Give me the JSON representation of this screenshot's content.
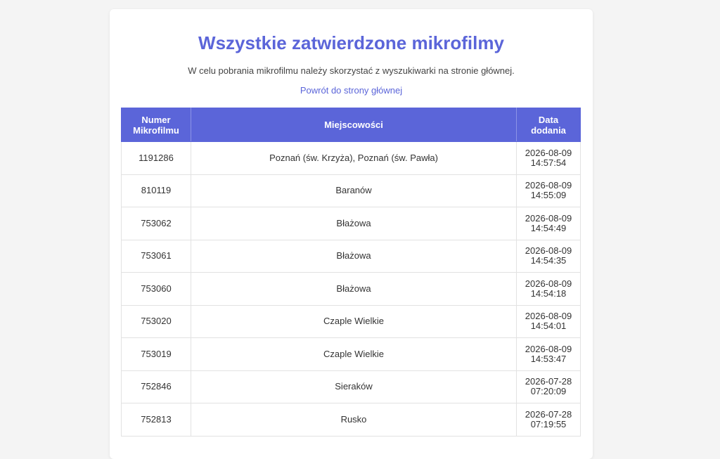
{
  "page": {
    "title": "Wszystkie zatwierdzone mikrofilmy",
    "subtitle": "W celu pobrania mikrofilmu należy skorzystać z wyszukiwarki na stronie głównej.",
    "back_link": "Powrót do strony głównej"
  },
  "colors": {
    "accent": "#5b65d9",
    "background": "#f4f4f4",
    "card": "#ffffff"
  },
  "table": {
    "headers": {
      "number": "Numer Mikrofilmu",
      "places": "Miejscowości",
      "date": "Data dodania"
    },
    "rows": [
      {
        "number": "1191286",
        "places": "Poznań (św. Krzyża), Poznań (św. Pawła)",
        "date": "2026-08-09",
        "time": "14:57:54"
      },
      {
        "number": "810119",
        "places": "Baranów",
        "date": "2026-08-09",
        "time": "14:55:09"
      },
      {
        "number": "753062",
        "places": "Błażowa",
        "date": "2026-08-09",
        "time": "14:54:49"
      },
      {
        "number": "753061",
        "places": "Błażowa",
        "date": "2026-08-09",
        "time": "14:54:35"
      },
      {
        "number": "753060",
        "places": "Błażowa",
        "date": "2026-08-09",
        "time": "14:54:18"
      },
      {
        "number": "753020",
        "places": "Czaple Wielkie",
        "date": "2026-08-09",
        "time": "14:54:01"
      },
      {
        "number": "753019",
        "places": "Czaple Wielkie",
        "date": "2026-08-09",
        "time": "14:53:47"
      },
      {
        "number": "752846",
        "places": "Sieraków",
        "date": "2026-07-28",
        "time": "07:20:09"
      },
      {
        "number": "752813",
        "places": "Rusko",
        "date": "2026-07-28",
        "time": "07:19:55"
      }
    ]
  }
}
